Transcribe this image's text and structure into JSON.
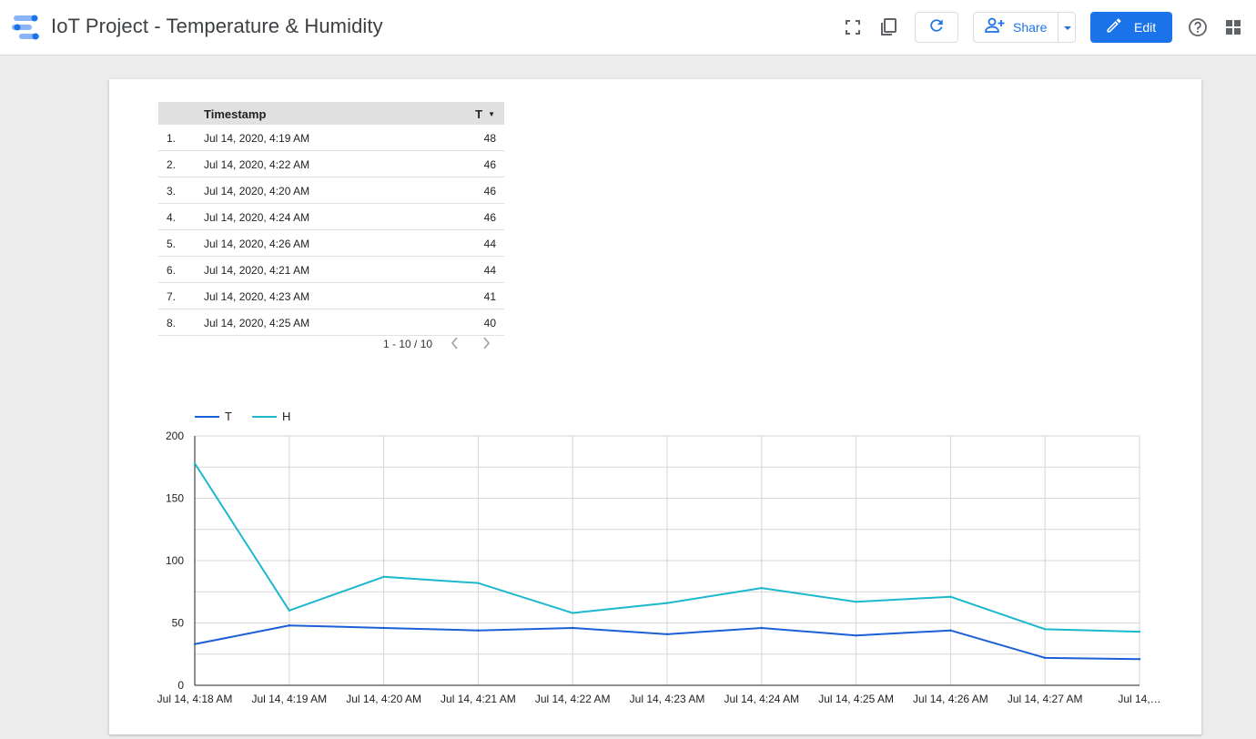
{
  "app": {
    "title": "IoT Project - Temperature & Humidity",
    "share_label": "Share",
    "edit_label": "Edit"
  },
  "table": {
    "headers": {
      "timestamp": "Timestamp",
      "t": "T"
    },
    "rows": [
      {
        "idx": "1.",
        "ts": "Jul 14, 2020, 4:19 AM",
        "t": "48"
      },
      {
        "idx": "2.",
        "ts": "Jul 14, 2020, 4:22 AM",
        "t": "46"
      },
      {
        "idx": "3.",
        "ts": "Jul 14, 2020, 4:20 AM",
        "t": "46"
      },
      {
        "idx": "4.",
        "ts": "Jul 14, 2020, 4:24 AM",
        "t": "46"
      },
      {
        "idx": "5.",
        "ts": "Jul 14, 2020, 4:26 AM",
        "t": "44"
      },
      {
        "idx": "6.",
        "ts": "Jul 14, 2020, 4:21 AM",
        "t": "44"
      },
      {
        "idx": "7.",
        "ts": "Jul 14, 2020, 4:23 AM",
        "t": "41"
      },
      {
        "idx": "8.",
        "ts": "Jul 14, 2020, 4:25 AM",
        "t": "40"
      }
    ],
    "pagination": "1 - 10 / 10"
  },
  "chart_data": {
    "type": "line",
    "categories": [
      "Jul 14, 4:18 AM",
      "Jul 14, 4:19 AM",
      "Jul 14, 4:20 AM",
      "Jul 14, 4:21 AM",
      "Jul 14, 4:22 AM",
      "Jul 14, 4:23 AM",
      "Jul 14, 4:24 AM",
      "Jul 14, 4:25 AM",
      "Jul 14, 4:26 AM",
      "Jul 14, 4:27 AM",
      "Jul 14,…"
    ],
    "series": [
      {
        "name": "T",
        "color": "#1a5fd6",
        "values": [
          33,
          48,
          46,
          44,
          46,
          41,
          46,
          40,
          44,
          22,
          21
        ]
      },
      {
        "name": "H",
        "color": "#1cb8cc",
        "values": [
          178,
          60,
          87,
          82,
          58,
          66,
          78,
          67,
          71,
          45,
          43
        ]
      }
    ],
    "yticks": [
      "0",
      "50",
      "100",
      "150",
      "200"
    ],
    "ylim": [
      0,
      200
    ],
    "grid": true,
    "legend": "top-left"
  }
}
